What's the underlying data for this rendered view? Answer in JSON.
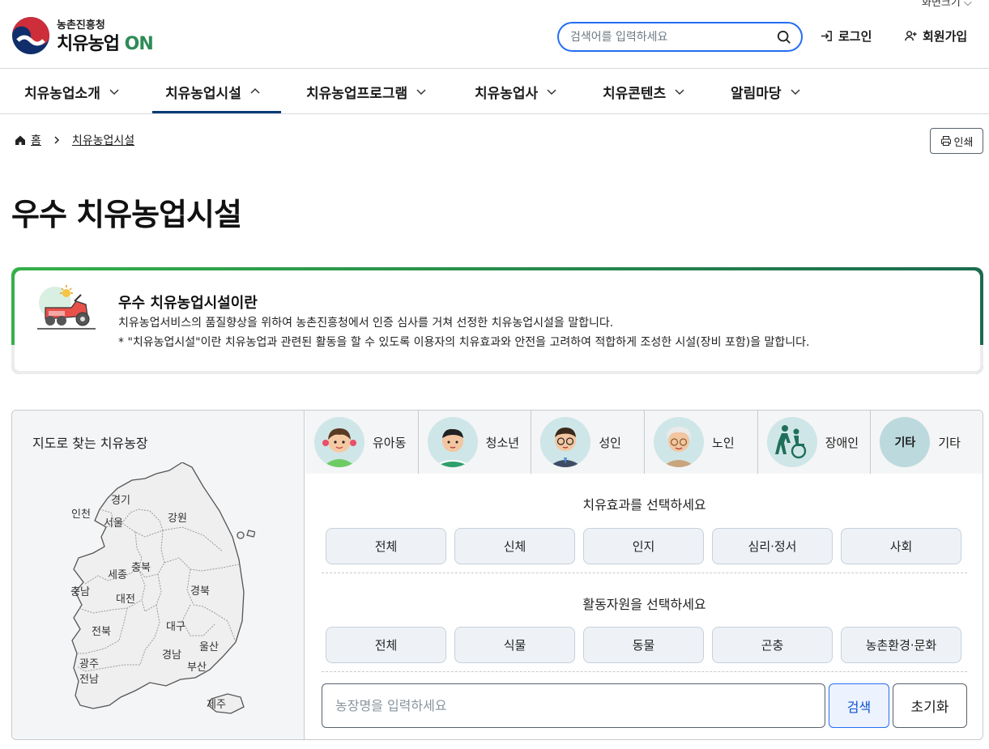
{
  "utility": {
    "zoom_label": "화면크기",
    "login": "로그인",
    "signup": "회원가입"
  },
  "logo": {
    "sub": "농촌진흥청",
    "main": "치유농업",
    "main_on": "ON"
  },
  "search": {
    "placeholder": "검색어를 입력하세요"
  },
  "gnb": [
    {
      "label": "치유농업소개"
    },
    {
      "label": "치유농업시설"
    },
    {
      "label": "치유농업프로그램"
    },
    {
      "label": "치유농업사"
    },
    {
      "label": "치유콘텐츠"
    },
    {
      "label": "알림마당"
    }
  ],
  "breadcrumb": {
    "home": "홈",
    "current": "치유농업시설"
  },
  "print_label": "인쇄",
  "page_title": "우수 치유농업시설",
  "intro": {
    "title": "우수 치유농업시설이란",
    "desc": "치유농업서비스의 품질향상을 위하여 농촌진흥청에서 인증 심사를 거쳐 선정한 치유농업시설을 말합니다.",
    "note": "* \"치유농업시설\"이란 치유농업과 관련된 활동을 할 수 있도록 이용자의 치유효과와 안전을 고려하여 적합하게 조성한 시설(장비 포함)을 말합니다."
  },
  "map": {
    "title": "지도로 찾는 치유농장",
    "regions": [
      "경기",
      "인천",
      "서울",
      "강원",
      "충북",
      "세종",
      "충남",
      "대전",
      "경북",
      "대구",
      "전북",
      "울산",
      "경남",
      "광주",
      "부산",
      "전남",
      "제주"
    ]
  },
  "targets": [
    {
      "label": "유아동",
      "icon": "child-icon"
    },
    {
      "label": "청소년",
      "icon": "teen-icon"
    },
    {
      "label": "성인",
      "icon": "adult-icon"
    },
    {
      "label": "노인",
      "icon": "senior-icon"
    },
    {
      "label": "장애인",
      "icon": "disabled-icon"
    },
    {
      "label": "기타",
      "icon_text": "기타"
    }
  ],
  "effects": {
    "title": "치유효과를 선택하세요",
    "options": [
      "전체",
      "신체",
      "인지",
      "심리·정서",
      "사회"
    ]
  },
  "resources": {
    "title": "활동자원을 선택하세요",
    "options": [
      "전체",
      "식물",
      "동물",
      "곤충",
      "농촌환경·문화"
    ]
  },
  "farm_search": {
    "placeholder": "농장명을 입력하세요",
    "search_button": "검색",
    "reset_button": "초기화"
  },
  "colors": {
    "accent": "#256ef4",
    "nav_active": "#063a74",
    "green": "#2e8b57"
  }
}
